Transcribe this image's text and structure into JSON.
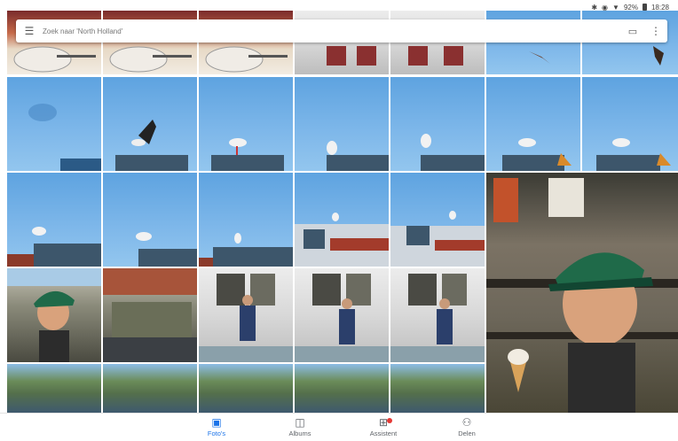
{
  "status_bar": {
    "battery_text": "92%",
    "time": "18:28",
    "icons": [
      "bluetooth-icon",
      "alarm-icon",
      "wifi-icon",
      "battery-icon"
    ]
  },
  "search": {
    "placeholder": "Zoek naar 'North Holland'",
    "menu_icon": "menu-icon",
    "cast_icon": "cast-icon",
    "more_icon": "more-vert-icon"
  },
  "photos": [
    {
      "name": "photo-dinner-plate-1",
      "subject": "food"
    },
    {
      "name": "photo-dinner-plate-2",
      "subject": "food"
    },
    {
      "name": "photo-dinner-plate-3",
      "subject": "food"
    },
    {
      "name": "photo-facade-1",
      "subject": "facade"
    },
    {
      "name": "photo-facade-2",
      "subject": "facade"
    },
    {
      "name": "photo-stork-flying-1",
      "subject": "sky"
    },
    {
      "name": "photo-stork-flying-2",
      "subject": "sky"
    },
    {
      "name": "photo-sky-blur",
      "subject": "sky"
    },
    {
      "name": "photo-stork-roof-1",
      "subject": "sky"
    },
    {
      "name": "photo-stork-roof-2",
      "subject": "sky"
    },
    {
      "name": "photo-stork-roof-3",
      "subject": "sky"
    },
    {
      "name": "photo-stork-roof-4",
      "subject": "sky"
    },
    {
      "name": "photo-stork-roof-5",
      "subject": "sky"
    },
    {
      "name": "photo-stork-roof-6",
      "subject": "sky"
    },
    {
      "name": "photo-stork-roof-7",
      "subject": "sky"
    },
    {
      "name": "photo-stork-roof-8",
      "subject": "sky"
    },
    {
      "name": "photo-stork-roof-9",
      "subject": "sky"
    },
    {
      "name": "photo-stork-building-1",
      "subject": "sky"
    },
    {
      "name": "photo-stork-building-2",
      "subject": "sky"
    },
    {
      "name": "photo-boy-icecream-large",
      "subject": "boy"
    },
    {
      "name": "photo-boy-icecream-small",
      "subject": "boy"
    },
    {
      "name": "photo-street-scene",
      "subject": "boy"
    },
    {
      "name": "photo-boy-window-1",
      "subject": "facade"
    },
    {
      "name": "photo-boy-window-2",
      "subject": "facade"
    },
    {
      "name": "photo-boy-window-3",
      "subject": "facade"
    },
    {
      "name": "photo-canal-1",
      "subject": "canal"
    },
    {
      "name": "photo-canal-2",
      "subject": "canal"
    },
    {
      "name": "photo-canal-3",
      "subject": "canal"
    },
    {
      "name": "photo-canal-4",
      "subject": "canal"
    },
    {
      "name": "photo-canal-5",
      "subject": "canal"
    }
  ],
  "nav": {
    "items": [
      {
        "label": "Foto's",
        "icon": "photo-icon",
        "active": true
      },
      {
        "label": "Albums",
        "icon": "album-icon",
        "active": false
      },
      {
        "label": "Assistent",
        "icon": "assistant-icon",
        "active": false,
        "badge": true
      },
      {
        "label": "Delen",
        "icon": "share-people-icon",
        "active": false
      }
    ]
  },
  "colors": {
    "accent": "#1a73e8",
    "badge": "#e53935"
  }
}
